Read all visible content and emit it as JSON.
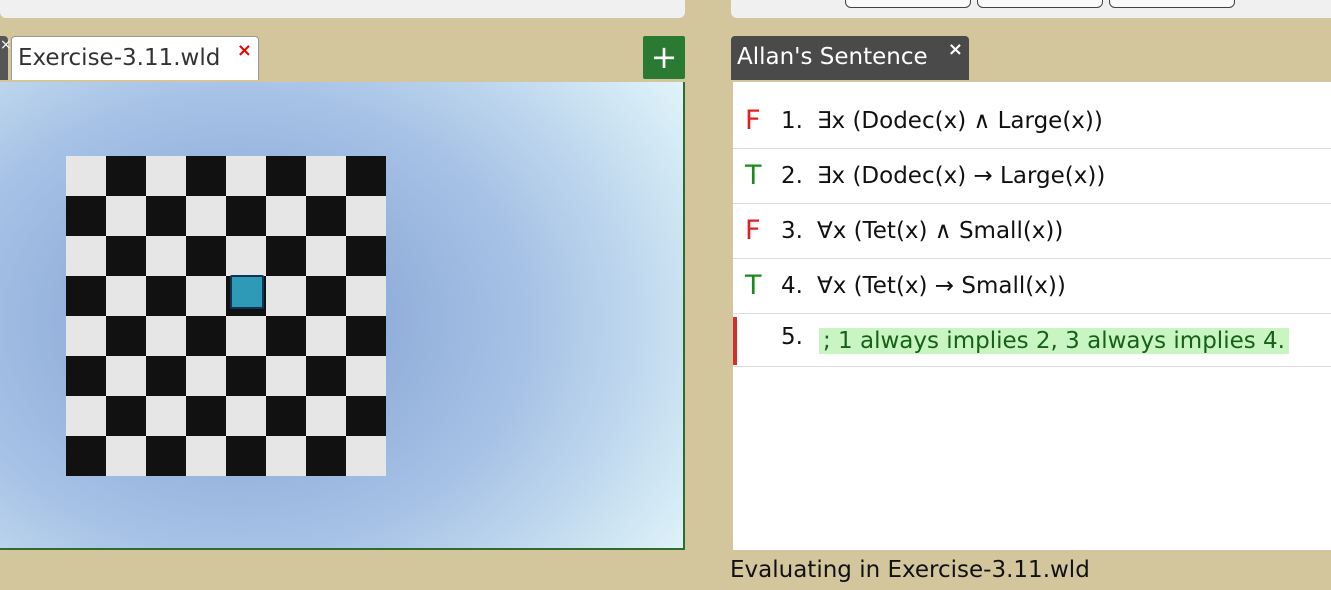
{
  "world_tabs": [
    {
      "label": "Exercise-3.11.wld",
      "close": "×"
    }
  ],
  "add_button": "+",
  "sentence_tab": {
    "label": "Allan's Sentence",
    "close": "×"
  },
  "sentences": [
    {
      "truth": "F",
      "num": "1.",
      "formula": "∃x (Dodec(x) ∧ Large(x))"
    },
    {
      "truth": "T",
      "num": "2.",
      "formula": "∃x (Dodec(x) → Large(x))"
    },
    {
      "truth": "F",
      "num": "3.",
      "formula": "∀x (Tet(x) ∧ Small(x))"
    },
    {
      "truth": "T",
      "num": "4.",
      "formula": "∀x (Tet(x) → Small(x))"
    },
    {
      "truth": "",
      "num": "5.",
      "formula": "; 1 always implies 2, 3 always implies 4."
    }
  ],
  "status": "Evaluating in Exercise-3.11.wld",
  "colors": {
    "false": "#e02020",
    "true": "#1a8a1a",
    "add_button": "#2a7a33",
    "block": "#2e9ab8"
  }
}
